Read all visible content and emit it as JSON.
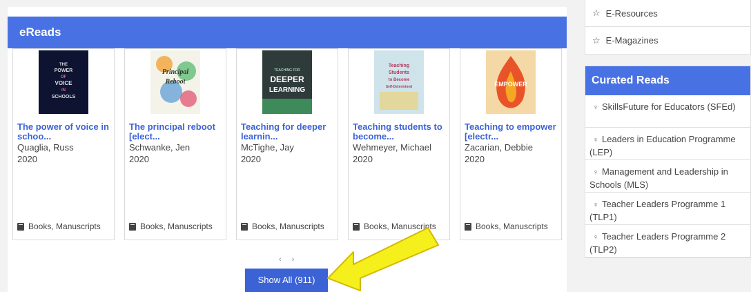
{
  "ereads": {
    "title": "eReads",
    "items": [
      {
        "title": "The power of voice in schoo...",
        "author": "Quaglia, Russ",
        "year": "2020",
        "type": "Books, Manuscripts",
        "cover": {
          "bg": "#0d1330",
          "text": "THE POWER OF VOICE IN SCHOOLS",
          "fg": "#e8e8e8"
        }
      },
      {
        "title": "The principal reboot [elect...",
        "author": "Schwanke, Jen",
        "year": "2020",
        "type": "Books, Manuscripts",
        "cover": {
          "bg": "#f3f3ea",
          "text": "Principal Reboot",
          "fg": "#2a6b3a"
        }
      },
      {
        "title": "Teaching for deeper learnin...",
        "author": "McTighe, Jay",
        "year": "2020",
        "type": "Books, Manuscripts",
        "cover": {
          "bg": "#2f3b3a",
          "text": "DEEPER LEARNING",
          "fg": "#ffffff"
        }
      },
      {
        "title": "Teaching students to become...",
        "author": "Wehmeyer, Michael",
        "year": "2020",
        "type": "Books, Manuscripts",
        "cover": {
          "bg": "#cfe3ea",
          "text": "Teaching Students to Become Self-Determined Learners",
          "fg": "#b03a5e"
        }
      },
      {
        "title": "Teaching to empower [electr...",
        "author": "Zacarian, Debbie",
        "year": "2020",
        "type": "Books, Manuscripts",
        "cover": {
          "bg": "#f4d9a6",
          "text": "EMPOWER",
          "fg": "#c0261b"
        }
      }
    ],
    "pager": "‹ ›",
    "show_all": "Show All (911)"
  },
  "resources": [
    {
      "label": "E-Resources",
      "icon": "star-icon"
    },
    {
      "label": "E-Magazines",
      "icon": "star-icon"
    }
  ],
  "curated": {
    "title": "Curated Reads",
    "items": [
      {
        "label": "SkillsFuture for Educators (SFEd)",
        "icon": "pin-icon"
      },
      {
        "label": "Leaders in Education Programme (LEP)",
        "icon": "pin-icon"
      },
      {
        "label": "Management and Leadership in Schools (MLS)",
        "icon": "pin-icon"
      },
      {
        "label": "Teacher Leaders Programme 1 (TLP1)",
        "icon": "pin-icon"
      },
      {
        "label": "Teacher Leaders Programme 2 (TLP2)",
        "icon": "pin-icon"
      }
    ]
  },
  "colors": {
    "accent": "#4872e4",
    "link": "#3b63d6",
    "arrow": "#f5ef1c"
  }
}
